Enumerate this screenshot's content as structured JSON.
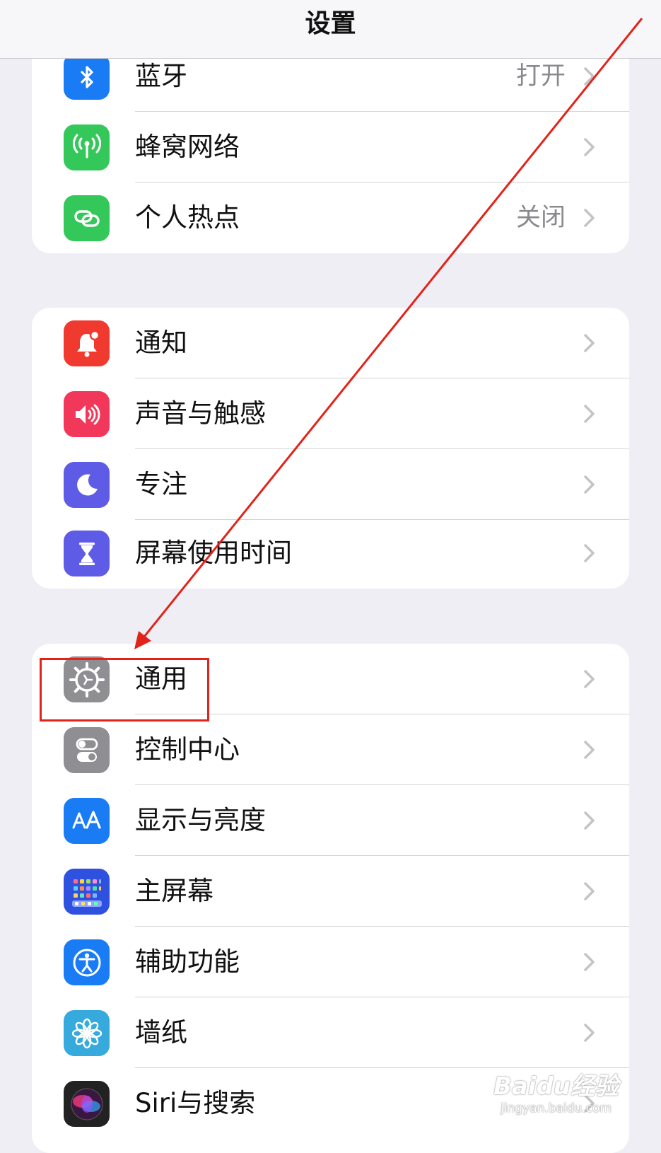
{
  "header": {
    "title": "设置"
  },
  "groups": [
    {
      "items": [
        {
          "label": "蓝牙",
          "value": "打开",
          "icon": "bluetooth-icon",
          "color": "#1a7cf5"
        },
        {
          "label": "蜂窝网络",
          "value": "",
          "icon": "cellular-icon",
          "color": "#34c759"
        },
        {
          "label": "个人热点",
          "value": "关闭",
          "icon": "hotspot-icon",
          "color": "#34c759"
        }
      ]
    },
    {
      "items": [
        {
          "label": "通知",
          "value": "",
          "icon": "notifications-icon",
          "color": "#f0392f"
        },
        {
          "label": "声音与触感",
          "value": "",
          "icon": "sound-icon",
          "color": "#f2385a"
        },
        {
          "label": "专注",
          "value": "",
          "icon": "moon-icon",
          "color": "#5e5ce6"
        },
        {
          "label": "屏幕使用时间",
          "value": "",
          "icon": "hourglass-icon",
          "color": "#5e5ce6"
        }
      ]
    },
    {
      "items": [
        {
          "label": "通用",
          "value": "",
          "icon": "gear-icon",
          "color": "#8e8e93"
        },
        {
          "label": "控制中心",
          "value": "",
          "icon": "toggles-icon",
          "color": "#8e8e93"
        },
        {
          "label": "显示与亮度",
          "value": "",
          "icon": "aa-icon",
          "color": "#1a7cf5"
        },
        {
          "label": "主屏幕",
          "value": "",
          "icon": "home-screen-icon",
          "color": "#2f51e0"
        },
        {
          "label": "辅助功能",
          "value": "",
          "icon": "accessibility-icon",
          "color": "#1a7cf5"
        },
        {
          "label": "墙纸",
          "value": "",
          "icon": "wallpaper-flower-icon",
          "color": "#36aadc"
        },
        {
          "label": "Siri与搜索",
          "value": "",
          "icon": "siri-icon",
          "color": "#222222"
        }
      ]
    }
  ],
  "watermark": {
    "brand": "Baidu经验",
    "url": "jingyan.baidu.com"
  },
  "annotation_color": "#e2231a"
}
